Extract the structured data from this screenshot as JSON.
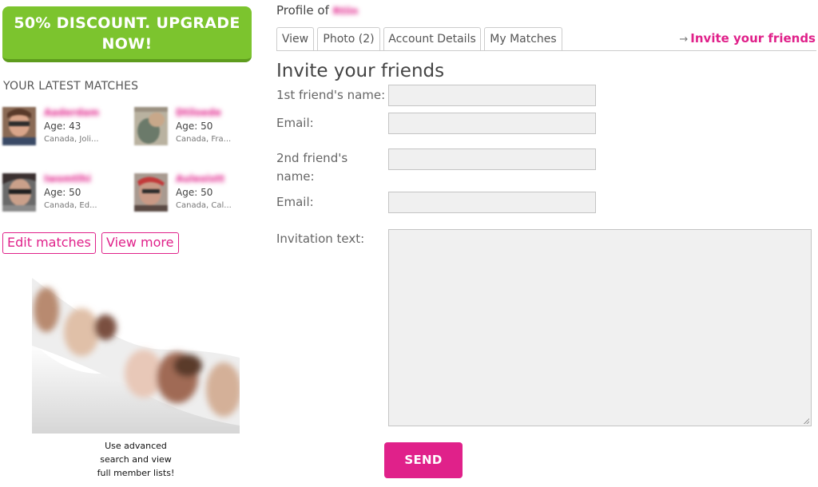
{
  "sidebar": {
    "upgrade_label": "50% DISCOUNT. UPGRADE NOW!",
    "latest_matches_heading": "YOUR LATEST MATCHES",
    "matches": [
      {
        "name": "Aaderdam",
        "age": "Age: 43",
        "location": "Canada, Joli..."
      },
      {
        "name": "Dtiloede",
        "age": "Age: 50",
        "location": "Canada, Fra..."
      },
      {
        "name": "Iwomtlhi",
        "age": "Age: 50",
        "location": "Canada, Ed..."
      },
      {
        "name": "Auleoistt",
        "age": "Age: 50",
        "location": "Canada, Cal..."
      }
    ],
    "edit_matches_label": "Edit matches",
    "view_more_label": "View more",
    "promo_caption": "Use advanced\nsearch and view\nfull member lists!"
  },
  "header": {
    "profile_of_label": "Profile of",
    "profile_name": "Rtiin",
    "tabs": [
      {
        "label": "View"
      },
      {
        "label": "Photo (2)"
      },
      {
        "label": "Account Details"
      },
      {
        "label": "My Matches"
      }
    ],
    "invite_link_label": "Invite your friends"
  },
  "form": {
    "title": "Invite your friends",
    "friend1_name_label": "1st friend's name:",
    "friend1_email_label": "Email:",
    "friend2_name_label": "2nd friend's name:",
    "friend2_email_label": "Email:",
    "invitation_text_label": "Invitation text:",
    "friend1_name_value": "",
    "friend1_email_value": "",
    "friend2_name_value": "",
    "friend2_email_value": "",
    "invitation_text_value": "",
    "send_label": "SEND"
  },
  "colors": {
    "accent": "#e0218a",
    "upgrade_green": "#7cc42e",
    "input_bg": "#f0f0f0"
  }
}
